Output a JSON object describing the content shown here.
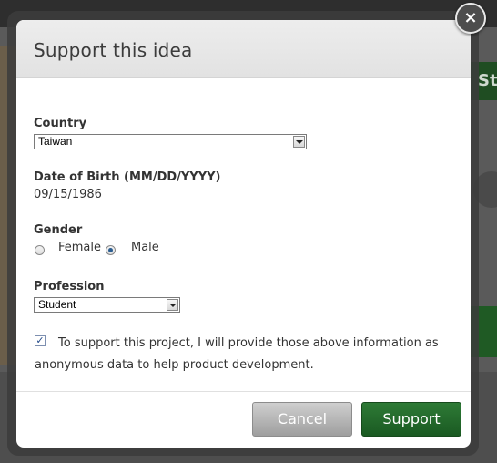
{
  "background": {
    "button_fragment": "St"
  },
  "modal": {
    "title": "Support this idea",
    "close_label": "×"
  },
  "form": {
    "country_label": "Country",
    "country_value": "Taiwan",
    "dob_label": "Date of Birth (MM/DD/YYYY)",
    "dob_value": "09/15/1986",
    "gender_label": "Gender",
    "gender_options": [
      "Female",
      "Male"
    ],
    "gender_selected": "Male",
    "profession_label": "Profession",
    "profession_value": "Student",
    "consent_checked": true,
    "consent_text": "To support this project, I will provide those above information as anonymous data to help product development."
  },
  "buttons": {
    "cancel_label": "Cancel",
    "support_label": "Support"
  },
  "colors": {
    "support_button": "#1f6a28",
    "cancel_button": "#b0b0b0",
    "radio_selected": "#2b5d91"
  }
}
